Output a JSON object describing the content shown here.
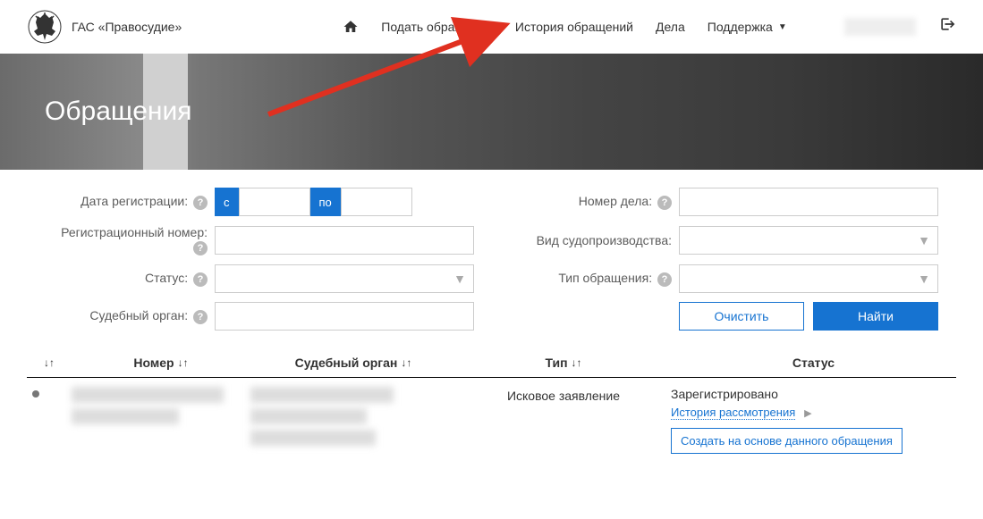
{
  "header": {
    "brand": "ГАС «Правосудие»",
    "nav": {
      "submit": "Подать обращение",
      "history": "История обращений",
      "cases": "Дела",
      "support": "Поддержка"
    }
  },
  "hero": {
    "title": "Обращения"
  },
  "filters": {
    "reg_date_label": "Дата регистрации:",
    "reg_date_from": "с",
    "reg_date_to": "по",
    "reg_number_label": "Регистрационный номер:",
    "status_label": "Статус:",
    "court_label": "Судебный орган:",
    "case_number_label": "Номер дела:",
    "proc_type_label": "Вид судопроизводства:",
    "appeal_type_label": "Тип обращения:",
    "clear_btn": "Очистить",
    "search_btn": "Найти"
  },
  "table": {
    "headers": {
      "number": "Номер",
      "court": "Судебный орган",
      "type": "Тип",
      "status": "Статус"
    },
    "row": {
      "type": "Исковое заявление",
      "status": "Зарегистрировано",
      "history_link": "История рассмотрения",
      "create_btn": "Создать на основе данного обращения"
    }
  }
}
